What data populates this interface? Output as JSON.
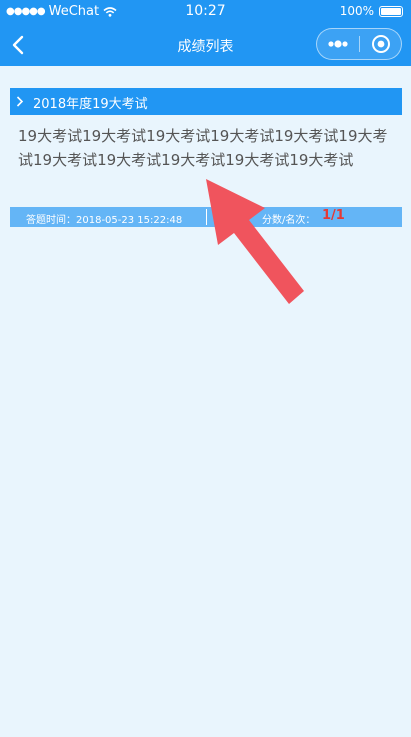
{
  "status_bar": {
    "signal_dots": "●●●●●",
    "carrier": "WeChat",
    "time": "10:27",
    "battery_percent": "100%"
  },
  "nav": {
    "title": "成绩列表"
  },
  "group": {
    "title": "2018年度19大考试"
  },
  "exam": {
    "title": "19大考试19大考试19大考试19大考试19大考试19大考试19大考试19大考试19大考试19大考试19大考试",
    "time_label": "答题时间：",
    "time_value": "2018-05-23 15:22:48",
    "score_label": "分数/名次：",
    "score_value": "1/1"
  },
  "colors": {
    "primary": "#2196f3",
    "info_bar": "#64b5f6",
    "background": "#e9f5fd",
    "score": "#e53935",
    "arrow": "#f0545d"
  }
}
